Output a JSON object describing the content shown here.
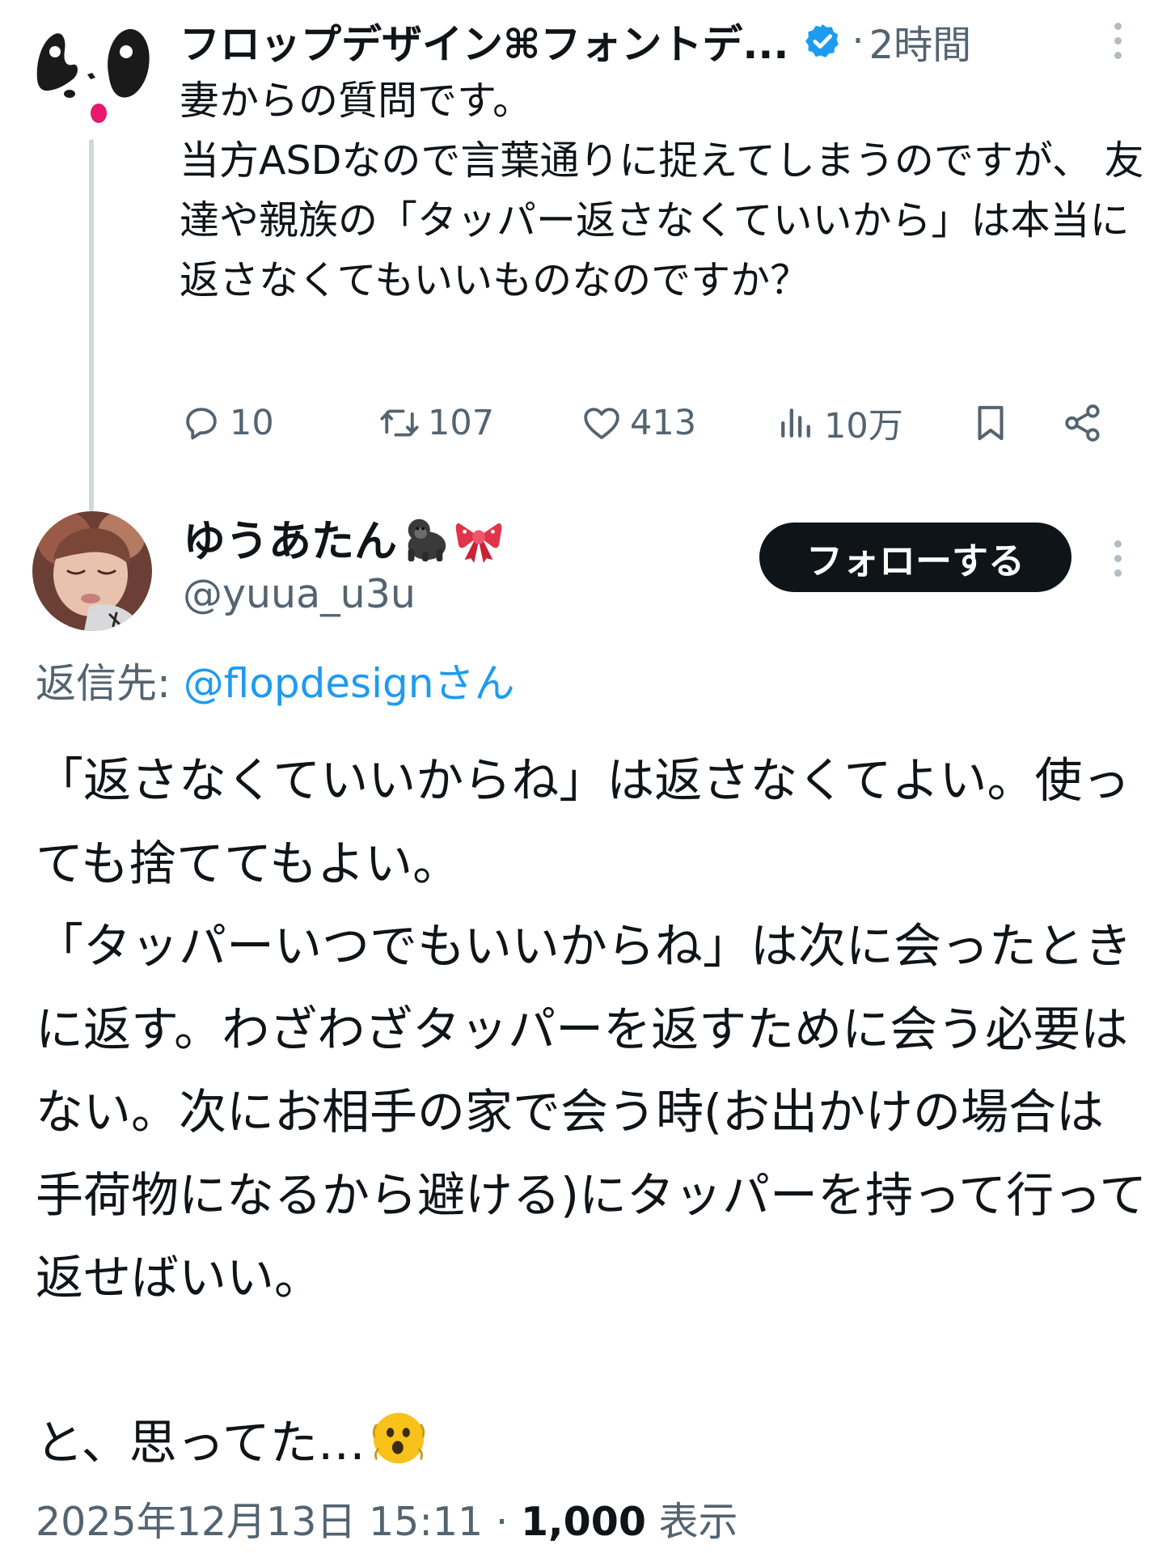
{
  "colors": {
    "text": "#0f1419",
    "secondary": "#536471",
    "link": "#1d9bf0",
    "verified": "#1d9bf0",
    "thread_line": "#cfd9de",
    "follow_bg": "#0f1419",
    "follow_text": "#ffffff"
  },
  "parent_tweet": {
    "display_name": "フロップデザイン⌘フォントデ...",
    "separator": "·",
    "time": "2時間",
    "text": "妻からの質問です。\n当方ASDなので言葉通りに捉えてしまうのですが、 友達や親族の「タッパー返さなくていいから」は本当に返さなくてもいいものなのですか？",
    "avatar_icon": "panda-face-logo-icon",
    "badge_icon": "verified-badge-icon",
    "actions": {
      "reply_count": "10",
      "retweet_count": "107",
      "like_count": "413",
      "view_count": "10万"
    },
    "action_icons": [
      "reply-icon",
      "retweet-icon",
      "like-icon",
      "views-icon",
      "bookmark-icon",
      "share-icon"
    ]
  },
  "reply_tweet": {
    "display_name": "ゆうあたん",
    "name_emojis": [
      "gorilla-emoji",
      "ribbon-emoji"
    ],
    "handle": "@yuua_u3u",
    "follow_label": "フォローする",
    "reply_to_label": "返信先: ",
    "reply_to_link": "@flopdesignさん",
    "text": "「返さなくていいからね」は返さなくてよい。使っても捨ててもよい。\n「タッパーいつでもいいからね」は次に会ったときに返す。わざわざタッパーを返すために会う必要はない。次にお相手の家で会う時(お出かけの場合は手荷物になるから避ける)にタッパーを持って行って返せばいい。",
    "tail_text": "と、思ってた…",
    "tail_emoji": "astonished-face-emoji",
    "date": "2025年12月13日 15:11",
    "meta_separator": " · ",
    "views": "1,000",
    "views_label": " 表示"
  }
}
